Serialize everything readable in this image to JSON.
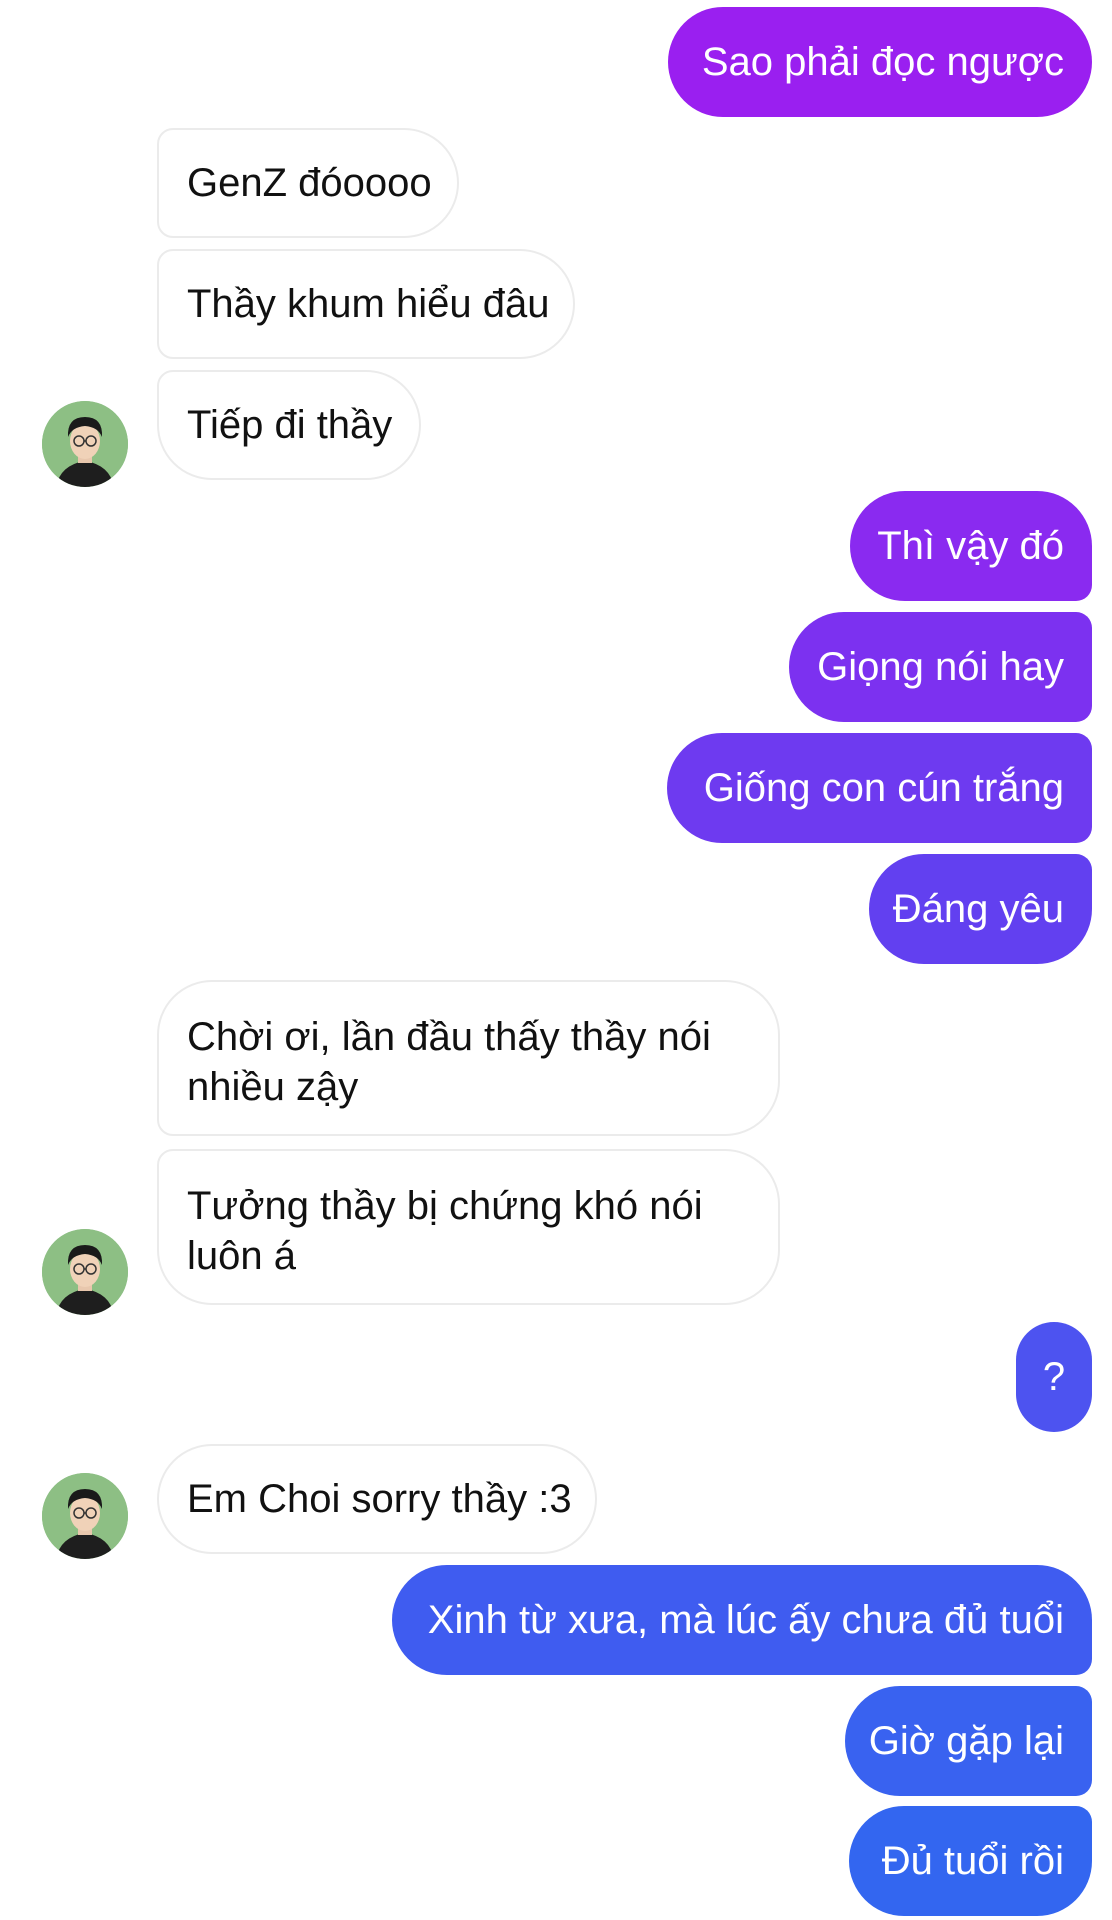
{
  "colors": {
    "outgoing_top": "#9b1ff0",
    "outgoing_mid": "#6c3bf0",
    "outgoing_bottom": "#3366f0",
    "incoming_bg": "#ffffff",
    "incoming_border": "#ebebeb",
    "avatar_bg": "#8dbf84"
  },
  "avatar_icon": "user-photo-icon",
  "messages": [
    {
      "from": "me",
      "text": "Sao phải đọc ngược"
    },
    {
      "from": "them",
      "text": "GenZ đóoooo"
    },
    {
      "from": "them",
      "text": "Thầy khum hiểu đâu"
    },
    {
      "from": "them",
      "text": "Tiếp đi thầy"
    },
    {
      "from": "me",
      "text": "Thì vậy đó"
    },
    {
      "from": "me",
      "text": "Giọng nói hay"
    },
    {
      "from": "me",
      "text": "Giống con cún trắng"
    },
    {
      "from": "me",
      "text": "Đáng yêu"
    },
    {
      "from": "them",
      "text": "Chời ơi, lần đầu thấy thầy nói nhiều zậy"
    },
    {
      "from": "them",
      "text": "Tưởng thầy bị chứng khó nói luôn á"
    },
    {
      "from": "me",
      "text": "?"
    },
    {
      "from": "them",
      "text": "Em Choi sorry thầy :3"
    },
    {
      "from": "me",
      "text": "Xinh từ xưa, mà lúc ấy chưa đủ tuổi"
    },
    {
      "from": "me",
      "text": "Giờ gặp lại"
    },
    {
      "from": "me",
      "text": "Đủ tuổi rồi"
    }
  ]
}
